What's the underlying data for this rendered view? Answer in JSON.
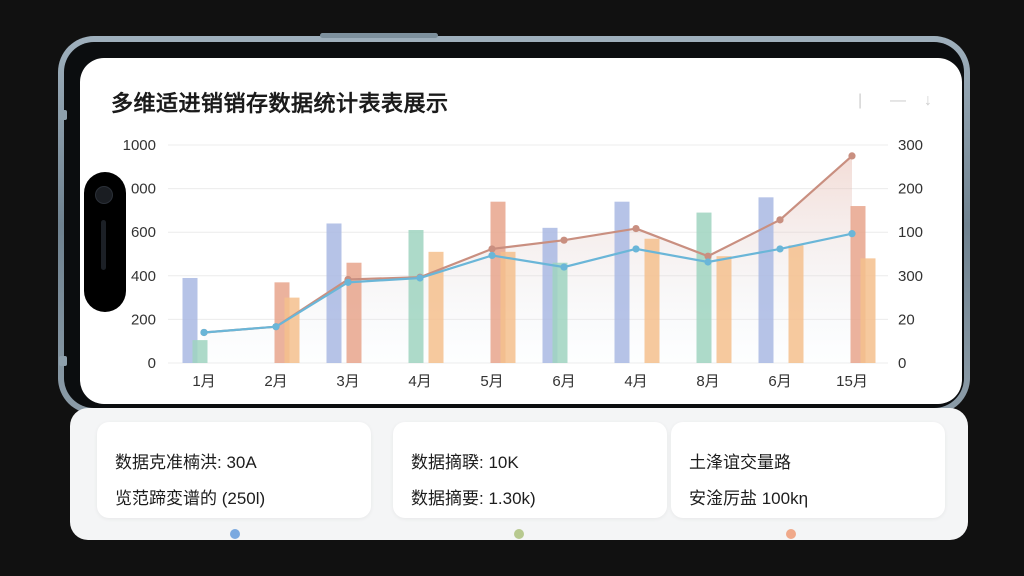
{
  "title": "多维适进销销存数据统计表表展示",
  "window_controls": [
    "|",
    "—",
    "↓"
  ],
  "chart_data": {
    "type": "bar",
    "categories": [
      "1月",
      "2月",
      "3月",
      "4月",
      "5月",
      "6月",
      "4月",
      "8月",
      "6月",
      "15月"
    ],
    "y_left_ticks": [
      "0",
      "200",
      "400",
      "600",
      "000",
      "1000"
    ],
    "y_right_ticks": [
      "0",
      "20",
      "300",
      "100",
      "200",
      "300"
    ],
    "ylim_left": [
      0,
      1000
    ],
    "ylim_right": [
      0,
      300
    ],
    "bar_series": [
      {
        "color": "#a9b9e3",
        "values": [
          390,
          0,
          640,
          0,
          0,
          620,
          740,
          0,
          760,
          0
        ]
      },
      {
        "color": "#9fd4bf",
        "values": [
          105,
          0,
          0,
          610,
          0,
          460,
          0,
          690,
          0,
          0
        ]
      },
      {
        "color": "#e8a58c",
        "values": [
          0,
          370,
          460,
          0,
          740,
          0,
          0,
          0,
          0,
          720
        ]
      },
      {
        "color": "#f5c08d",
        "values": [
          0,
          300,
          0,
          510,
          510,
          0,
          570,
          490,
          540,
          480
        ]
      }
    ],
    "line_series": [
      {
        "color": "#c98f80",
        "values": [
          42,
          50,
          115,
          118,
          157,
          169,
          185,
          147,
          197,
          285
        ]
      },
      {
        "color": "#6ab6d8",
        "values": [
          42,
          50,
          111,
          117,
          148,
          132,
          157,
          139,
          157,
          178
        ]
      }
    ],
    "grid": true,
    "legend_dot_colors": [
      "#7aa9e0",
      "#b7c98f",
      "#f0a98a"
    ]
  },
  "cards": [
    {
      "line1": "数据克准楠洪: 30A",
      "line2": "览范蹄変谱的 (250l)"
    },
    {
      "line1": "数据摘聧: 10K",
      "line2": "数据摘要: 1.30k)"
    },
    {
      "line1": "土浲谊交量路",
      "line2": "安淦厉盐 100kη"
    }
  ]
}
